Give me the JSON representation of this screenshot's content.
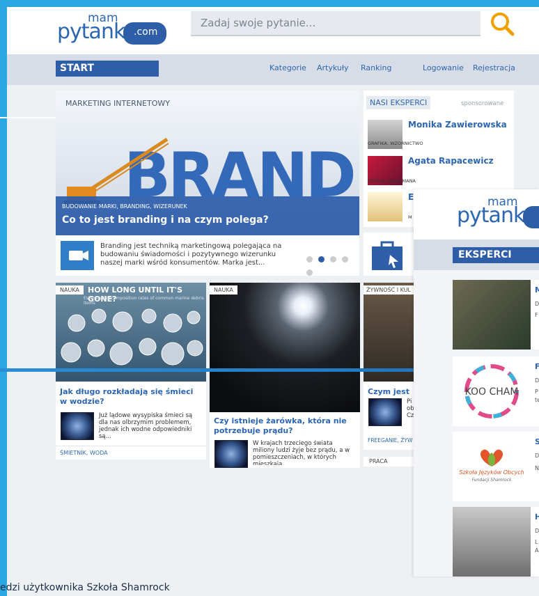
{
  "logo": {
    "mam": "mam",
    "pytank": "pytank",
    "com": ".com"
  },
  "search": {
    "placeholder": "Zadaj swoje pytanie..."
  },
  "nav": {
    "start": "START",
    "links": [
      "Kategorie",
      "Artykuły",
      "Ranking",
      "Logowanie",
      "Rejestracja"
    ]
  },
  "hero": {
    "category": "MARKETING INTERNETOWY",
    "tags": "BUDOWANIE MARKI, BRANDING, WIZERUNEK",
    "title": "Co to jest branding i na czym polega?",
    "description": "Branding jest techniką marketingową polegająca na budowaniu świadomości i pozytywnego wizerunku naszej marki wśród konsumentów. Marka jest...",
    "brand_word": "BRAND",
    "slider": {
      "total": 5,
      "active": 2
    }
  },
  "experts": {
    "title": "NASI EKSPERCI",
    "sponsored": "sponsorowane",
    "items": [
      {
        "name": "Monika Zawierowska",
        "role": "GRAFIKA, WZORNICTWO"
      },
      {
        "name": "Agata Rapacewicz",
        "role": "ZESPÓŁ ANGELMANA"
      },
      {
        "name": "E",
        "role": "M"
      }
    ]
  },
  "cards": [
    {
      "tag": "NAUKA",
      "img_title": "HOW LONG UNTIL IT'S GONE?",
      "img_subtitle": "Estimated decomposition rates of common marine debris items",
      "title": "Jak długo rozkładają się śmieci w wodzie?",
      "desc": "Już lądowe wysypiska śmieci są dla nas olbrzymim problemem, jednak ich wodne odpowiedniki są...",
      "footer": "ŚMIETNIK, WODA"
    },
    {
      "tag": "NAUKA",
      "title": "Czy istnieje żarówka, która nie potrzebuje prądu?",
      "desc": "W krajach trzeciego świata miliony ludzi żyje bez prądu, a w pomieszczeniach, w których mieszkaja"
    },
    {
      "tag": "ŻYWNOŚĆ I KUL",
      "title": "Czym jest Fr",
      "desc": "Pi w ob Cz",
      "footer": "FREEGANIE, ŻYW",
      "footer2": "PRACA"
    }
  ],
  "overlay": {
    "section": "EKSPERCI",
    "rows": [
      {
        "initial": "M",
        "lines": [
          "D",
          "F"
        ]
      },
      {
        "initial": "F",
        "lines": [
          "D",
          "P",
          "te"
        ],
        "logo": "KOO CHAM"
      },
      {
        "initial": "S",
        "lines": [
          "D",
          "N"
        ],
        "logo": "Szkoła Języków Obcych",
        "logo_sub": "Fundacji Shamrock"
      },
      {
        "initial": "H",
        "lines": [
          "D",
          "L",
          "A"
        ]
      }
    ]
  },
  "bottom_text": "edzi użytkownika Szkoła Shamrock",
  "colors": {
    "brand_blue": "#2f5ea8",
    "frame": "#2aa6e0",
    "search_icon": "#f0a100"
  }
}
